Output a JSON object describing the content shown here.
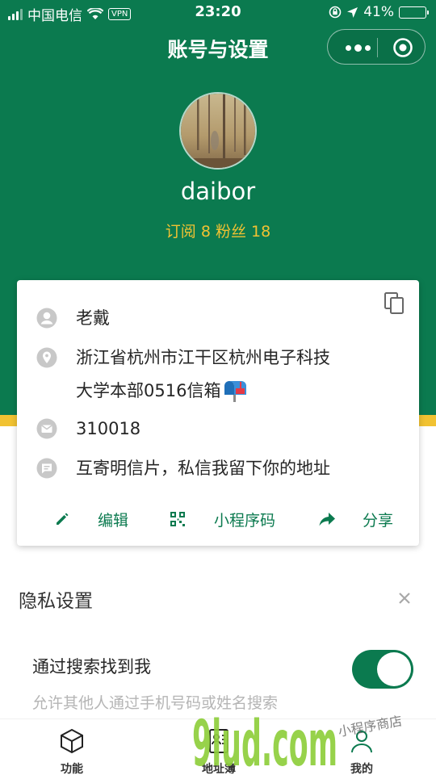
{
  "status_bar": {
    "carrier": "中国电信",
    "vpn": "VPN",
    "time": "23:20",
    "battery": "41%",
    "battery_level": 0.41
  },
  "nav": {
    "title": "账号与设置"
  },
  "profile": {
    "username": "daibor",
    "stats": "订阅 8 粉丝 18"
  },
  "card": {
    "name": "老戴",
    "address_line1": "浙江省杭州市江干区杭州电子科技",
    "address_line2": "大学本部0516信箱",
    "zip": "310018",
    "note": "互寄明信片，私信我留下你的地址",
    "actions": {
      "edit": "编辑",
      "qrcode": "小程序码",
      "share": "分享"
    }
  },
  "privacy": {
    "title": "隐私设置",
    "search_label": "通过搜索找到我",
    "search_enabled": true,
    "search_desc": "允许其他人通过手机号码或姓名搜索"
  },
  "tabbar": {
    "tabs": [
      {
        "label": "功能"
      },
      {
        "label": "地址簿"
      },
      {
        "label": "我的"
      }
    ]
  },
  "watermark": {
    "brand": "9lud.com",
    "small": "小程序商店"
  },
  "colors": {
    "primary": "#0b7a4f",
    "accent": "#f1c232"
  }
}
